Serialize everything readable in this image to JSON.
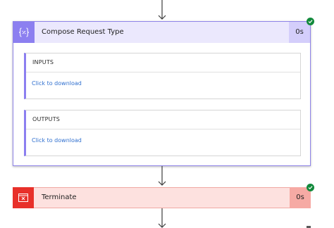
{
  "flow": {
    "compose": {
      "title": "Compose Request Type",
      "duration": "0s",
      "icon": "code-braces-icon",
      "status": "success",
      "accent_color": "#8c7ff0",
      "inputs": {
        "title": "INPUTS",
        "link": "Click to download"
      },
      "outputs": {
        "title": "OUTPUTS",
        "link": "Click to download"
      }
    },
    "terminate": {
      "title": "Terminate",
      "duration": "0s",
      "icon": "terminate-icon",
      "status": "success",
      "accent_color": "#e8302a"
    },
    "connector_icon": "arrow-down-icon",
    "status_color": "#128a3c"
  }
}
